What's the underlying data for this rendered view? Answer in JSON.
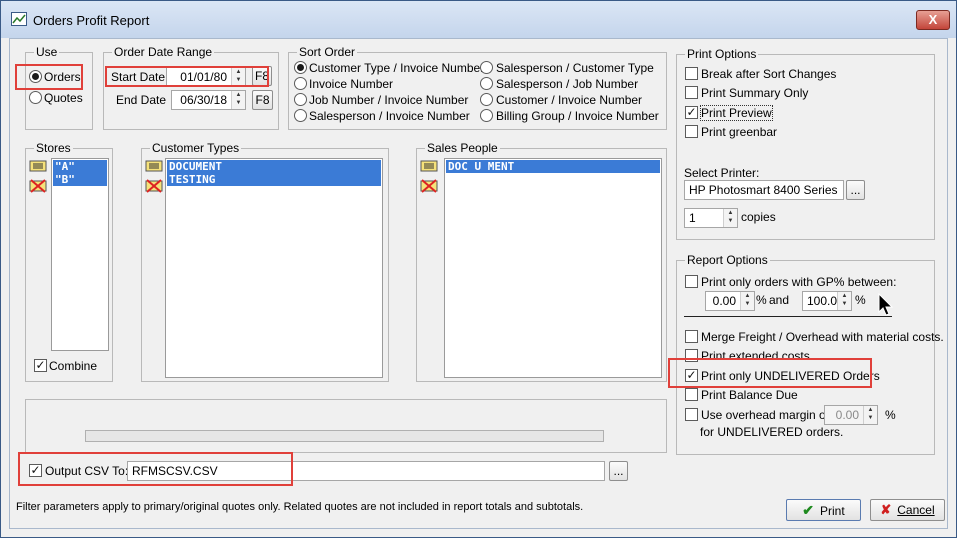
{
  "window": {
    "title": "Orders Profit Report",
    "close_label": "X"
  },
  "use": {
    "legend": "Use",
    "options": [
      {
        "label": "Orders",
        "selected": true
      },
      {
        "label": "Quotes",
        "selected": false
      }
    ]
  },
  "date_range": {
    "legend": "Order Date Range",
    "start_label": "Start Date",
    "start_value": "01/01/80",
    "end_label": "End Date",
    "end_value": "06/30/18",
    "key_button": "F8"
  },
  "sort_order": {
    "legend": "Sort Order",
    "options": [
      {
        "label": "Customer Type / Invoice Number",
        "selected": true
      },
      {
        "label": "Invoice Number",
        "selected": false
      },
      {
        "label": "Job Number / Invoice Number",
        "selected": false
      },
      {
        "label": "Salesperson / Invoice Number",
        "selected": false
      },
      {
        "label": "Salesperson / Customer Type",
        "selected": false
      },
      {
        "label": "Salesperson / Job Number",
        "selected": false
      },
      {
        "label": "Customer / Invoice Number",
        "selected": false
      },
      {
        "label": "Billing Group / Invoice Number",
        "selected": false
      }
    ]
  },
  "stores": {
    "legend": "Stores",
    "items": [
      "\"A\"",
      "\"B\""
    ],
    "combine_label": "Combine",
    "combine_checked": true
  },
  "customer_types": {
    "legend": "Customer Types",
    "items": [
      "DOCUMENT",
      "TESTING"
    ]
  },
  "sales_people": {
    "legend": "Sales People",
    "items": [
      "DOC U MENT"
    ]
  },
  "print_options": {
    "legend": "Print Options",
    "checks": [
      {
        "label": "Break after Sort Changes",
        "checked": false
      },
      {
        "label": "Print Summary Only",
        "checked": false
      },
      {
        "label": "Print Preview",
        "checked": true
      },
      {
        "label": "Print greenbar",
        "checked": false
      }
    ],
    "printer_label": "Select Printer:",
    "printer_value": "HP Photosmart 8400 Series",
    "browse_label": "...",
    "copies_value": "1",
    "copies_label": "copies"
  },
  "report_options": {
    "legend": "Report Options",
    "gp_label": "Print only orders with GP% between:",
    "gp_low": "0.00",
    "percent": "%",
    "and_label": "and",
    "gp_high": "100.0",
    "merge_label": "Merge Freight / Overhead with material costs.",
    "extended_label": "Print extended costs",
    "undelivered_label": "Print only UNDELIVERED Orders",
    "balance_label": "Print Balance Due",
    "overhead_label": "Use overhead margin of",
    "overhead_value": "0.00",
    "overhead_sub": "for UNDELIVERED orders."
  },
  "output": {
    "label": "Output CSV To:",
    "checked": true,
    "value": "RFMSCSV.CSV",
    "browse_label": "..."
  },
  "footer": {
    "note": "Filter parameters apply to primary/original quotes only.  Related quotes are not included in report totals and subtotals.",
    "print_label": "Print",
    "cancel_label": "Cancel"
  },
  "icons": [
    "report-icon",
    "select-all-icon",
    "clear-selection-icon",
    "checkmark-icon",
    "x-icon",
    "spin-arrows-icon",
    "mouse-pointer-icon"
  ],
  "colors": {
    "selection": "#3b7bd6",
    "highlight": "#e0403a",
    "title_bar": "#c4d5ec"
  }
}
